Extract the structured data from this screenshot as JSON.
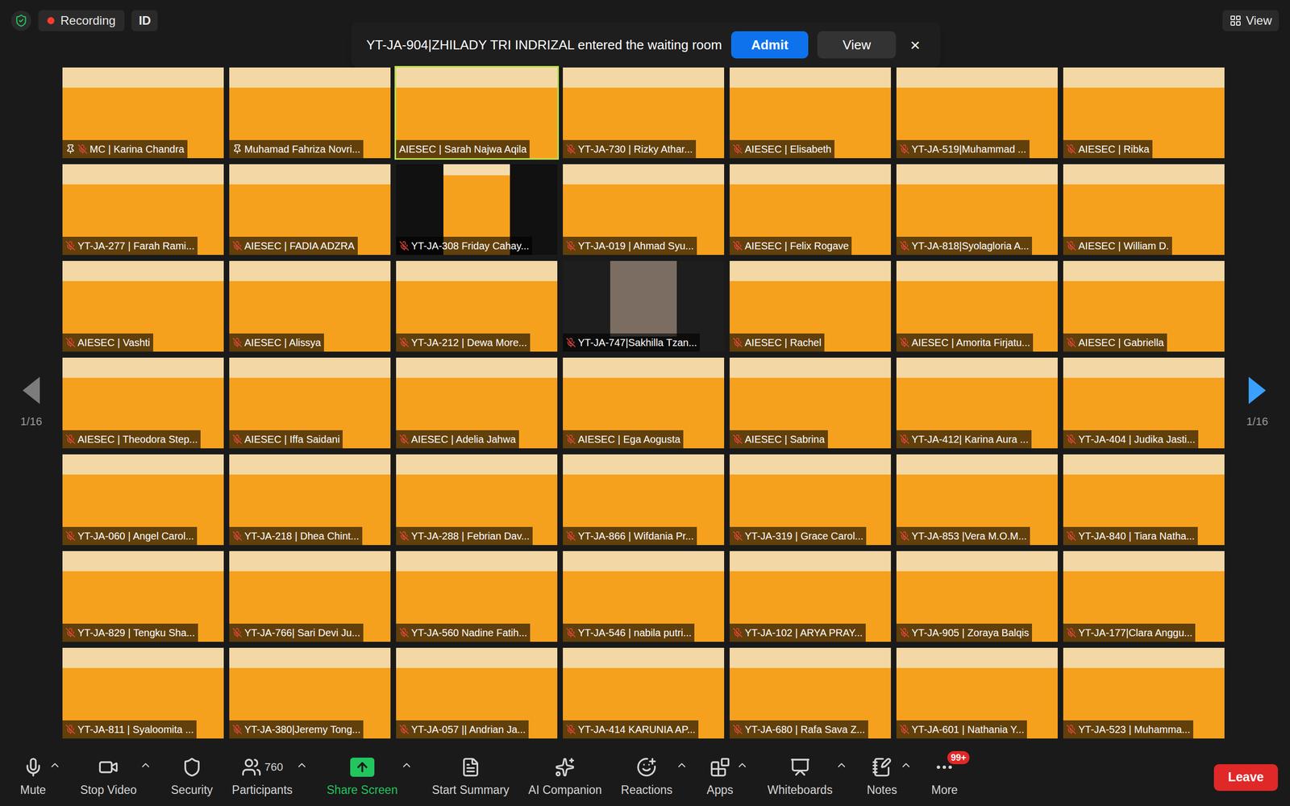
{
  "top_bar": {
    "recording": {
      "label": "Recording",
      "on": true
    },
    "id_badge": "ID",
    "view_button": "View"
  },
  "notification": {
    "message": "YT-JA-904|ZHILADY TRI INDRIZAL entered the waiting room",
    "primary_button": "Admit",
    "secondary_button": "View",
    "close": "×"
  },
  "pager": {
    "left_label": "1/16",
    "right_label": "1/16",
    "prev_enabled": false,
    "next_enabled": true
  },
  "participants": [
    {
      "name": "MC | Karina Chandra",
      "muted": true,
      "pinned": true,
      "speaking": false,
      "kind": "full"
    },
    {
      "name": "Muhamad Fahriza Novri...",
      "muted": false,
      "pinned": true,
      "speaking": false,
      "kind": "full"
    },
    {
      "name": "AIESEC | Sarah Najwa Aqila",
      "muted": false,
      "pinned": false,
      "speaking": true,
      "kind": "full"
    },
    {
      "name": "YT-JA-730 | Rizky Athar...",
      "muted": true,
      "pinned": false,
      "speaking": false,
      "kind": "full"
    },
    {
      "name": "AIESEC | Elisabeth",
      "muted": true,
      "pinned": false,
      "speaking": false,
      "kind": "full"
    },
    {
      "name": "YT-JA-519|Muhammad ...",
      "muted": true,
      "pinned": false,
      "speaking": false,
      "kind": "full"
    },
    {
      "name": "AIESEC | Ribka",
      "muted": true,
      "pinned": false,
      "speaking": false,
      "kind": "full"
    },
    {
      "name": "YT-JA-277 | Farah Rami...",
      "muted": true,
      "pinned": false,
      "speaking": false,
      "kind": "full"
    },
    {
      "name": "AIESEC | FADIA ADZRA",
      "muted": true,
      "pinned": false,
      "speaking": false,
      "kind": "full"
    },
    {
      "name": "YT-JA-308 Friday Cahay...",
      "muted": true,
      "pinned": false,
      "speaking": false,
      "kind": "pillarbox"
    },
    {
      "name": "YT-JA-019 | Ahmad Syu...",
      "muted": true,
      "pinned": false,
      "speaking": false,
      "kind": "full"
    },
    {
      "name": "AIESEC | Felix Rogave",
      "muted": true,
      "pinned": false,
      "speaking": false,
      "kind": "full"
    },
    {
      "name": "YT-JA-818|Syolagloria A...",
      "muted": true,
      "pinned": false,
      "speaking": false,
      "kind": "full"
    },
    {
      "name": "AIESEC | William D.",
      "muted": true,
      "pinned": false,
      "speaking": false,
      "kind": "full"
    },
    {
      "name": "AIESEC | Vashti",
      "muted": true,
      "pinned": false,
      "speaking": false,
      "kind": "full"
    },
    {
      "name": "AIESEC | Alissya",
      "muted": true,
      "pinned": false,
      "speaking": false,
      "kind": "full"
    },
    {
      "name": "YT-JA-212 | Dewa More...",
      "muted": true,
      "pinned": false,
      "speaking": false,
      "kind": "full"
    },
    {
      "name": "YT-JA-747|Sakhilla Tzan...",
      "muted": true,
      "pinned": false,
      "speaking": false,
      "kind": "photo"
    },
    {
      "name": "AIESEC | Rachel",
      "muted": true,
      "pinned": false,
      "speaking": false,
      "kind": "full"
    },
    {
      "name": "AIESEC | Amorita Firjatu...",
      "muted": true,
      "pinned": false,
      "speaking": false,
      "kind": "full"
    },
    {
      "name": "AIESEC | Gabriella",
      "muted": true,
      "pinned": false,
      "speaking": false,
      "kind": "full"
    },
    {
      "name": "AIESEC | Theodora Step...",
      "muted": true,
      "pinned": false,
      "speaking": false,
      "kind": "full"
    },
    {
      "name": "AIESEC | Iffa Saidani",
      "muted": true,
      "pinned": false,
      "speaking": false,
      "kind": "full"
    },
    {
      "name": "AIESEC | Adelia Jahwa",
      "muted": true,
      "pinned": false,
      "speaking": false,
      "kind": "full"
    },
    {
      "name": "AIESEC | Ega Aogusta",
      "muted": true,
      "pinned": false,
      "speaking": false,
      "kind": "full"
    },
    {
      "name": "AIESEC | Sabrina",
      "muted": true,
      "pinned": false,
      "speaking": false,
      "kind": "full"
    },
    {
      "name": "YT-JA-412| Karina Aura ...",
      "muted": true,
      "pinned": false,
      "speaking": false,
      "kind": "full"
    },
    {
      "name": "YT-JA-404 | Judika Jasti...",
      "muted": true,
      "pinned": false,
      "speaking": false,
      "kind": "full"
    },
    {
      "name": "YT-JA-060 | Angel Carol...",
      "muted": true,
      "pinned": false,
      "speaking": false,
      "kind": "full"
    },
    {
      "name": "YT-JA-218 | Dhea Chint...",
      "muted": true,
      "pinned": false,
      "speaking": false,
      "kind": "full"
    },
    {
      "name": "YT-JA-288 | Febrian Dav...",
      "muted": true,
      "pinned": false,
      "speaking": false,
      "kind": "full"
    },
    {
      "name": "YT-JA-866 | Wifdania Pr...",
      "muted": true,
      "pinned": false,
      "speaking": false,
      "kind": "full"
    },
    {
      "name": "YT-JA-319 | Grace Carol...",
      "muted": true,
      "pinned": false,
      "speaking": false,
      "kind": "full"
    },
    {
      "name": "YT-JA-853 |Vera M.O.M...",
      "muted": true,
      "pinned": false,
      "speaking": false,
      "kind": "full"
    },
    {
      "name": "YT-JA-840 | Tiara Natha...",
      "muted": true,
      "pinned": false,
      "speaking": false,
      "kind": "full"
    },
    {
      "name": "YT-JA-829 | Tengku Sha...",
      "muted": true,
      "pinned": false,
      "speaking": false,
      "kind": "full"
    },
    {
      "name": "YT-JA-766| Sari Devi Ju...",
      "muted": true,
      "pinned": false,
      "speaking": false,
      "kind": "full"
    },
    {
      "name": "YT-JA-560 Nadine Fatih...",
      "muted": true,
      "pinned": false,
      "speaking": false,
      "kind": "full"
    },
    {
      "name": "YT-JA-546 | nabila putri...",
      "muted": true,
      "pinned": false,
      "speaking": false,
      "kind": "full"
    },
    {
      "name": "YT-JA-102 | ARYA PRAY...",
      "muted": true,
      "pinned": false,
      "speaking": false,
      "kind": "full"
    },
    {
      "name": "YT-JA-905 | Zoraya Balqis",
      "muted": true,
      "pinned": false,
      "speaking": false,
      "kind": "full"
    },
    {
      "name": "YT-JA-177|Clara Anggu...",
      "muted": true,
      "pinned": false,
      "speaking": false,
      "kind": "full"
    },
    {
      "name": "YT-JA-811 | Syaloomita ...",
      "muted": true,
      "pinned": false,
      "speaking": false,
      "kind": "full"
    },
    {
      "name": "YT-JA-380|Jeremy Tong...",
      "muted": true,
      "pinned": false,
      "speaking": false,
      "kind": "full"
    },
    {
      "name": "YT-JA-057 || Andrian Ja...",
      "muted": true,
      "pinned": false,
      "speaking": false,
      "kind": "full"
    },
    {
      "name": "YT-JA-414 KARUNIA AP...",
      "muted": true,
      "pinned": false,
      "speaking": false,
      "kind": "full"
    },
    {
      "name": "YT-JA-680 | Rafa Sava Z...",
      "muted": true,
      "pinned": false,
      "speaking": false,
      "kind": "full"
    },
    {
      "name": "YT-JA-601 | Nathania Y...",
      "muted": true,
      "pinned": false,
      "speaking": false,
      "kind": "full"
    },
    {
      "name": "YT-JA-523 | Muhamma...",
      "muted": true,
      "pinned": false,
      "speaking": false,
      "kind": "full"
    }
  ],
  "toolbar": {
    "items": [
      {
        "label": "Mute",
        "caret": true,
        "highlighted": false
      },
      {
        "label": "Stop Video",
        "caret": true,
        "highlighted": false
      },
      {
        "label": "Security",
        "caret": false,
        "highlighted": false
      },
      {
        "label": "Participants",
        "caret": true,
        "highlighted": false,
        "count": "760"
      },
      {
        "label": "Share Screen",
        "caret": true,
        "highlighted": true
      },
      {
        "label": "Start Summary",
        "caret": false,
        "highlighted": false
      },
      {
        "label": "AI Companion",
        "caret": false,
        "highlighted": false
      },
      {
        "label": "Reactions",
        "caret": true,
        "highlighted": false
      },
      {
        "label": "Apps",
        "caret": true,
        "highlighted": false
      },
      {
        "label": "Whiteboards",
        "caret": true,
        "highlighted": false
      },
      {
        "label": "Notes",
        "caret": true,
        "highlighted": false
      },
      {
        "label": "More",
        "caret": false,
        "highlighted": false,
        "badge": "99+"
      }
    ],
    "leave_button": "Leave"
  }
}
